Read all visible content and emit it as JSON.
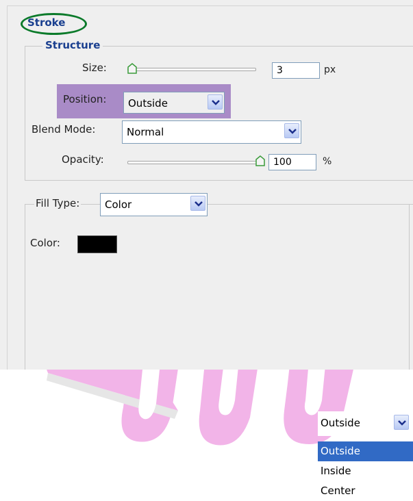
{
  "watermark": {
    "color": "#f2b4e8"
  },
  "panel": {
    "title": "Stroke",
    "title_oval_color": "#0b7a2a",
    "title_color": "#1a3f8f"
  },
  "structure": {
    "title": "Structure",
    "size_label": "Size:",
    "size_value": "3",
    "size_unit": "px",
    "position_label": "Position:",
    "position_value": "Outside",
    "position_highlight_color": "#a98bc7",
    "blend_mode_label": "Blend Mode:",
    "blend_mode_value": "Normal",
    "opacity_label": "Opacity:",
    "opacity_value": "100",
    "opacity_unit": "%"
  },
  "fill": {
    "fill_type_label": "Fill Type:",
    "fill_type_value": "Color",
    "color_label": "Color:",
    "color_swatch": "#000000"
  },
  "dropdown_popup": {
    "selected_value": "Outside",
    "options": [
      "Outside",
      "Inside",
      "Center"
    ],
    "highlighted_color": "#316ac5"
  }
}
